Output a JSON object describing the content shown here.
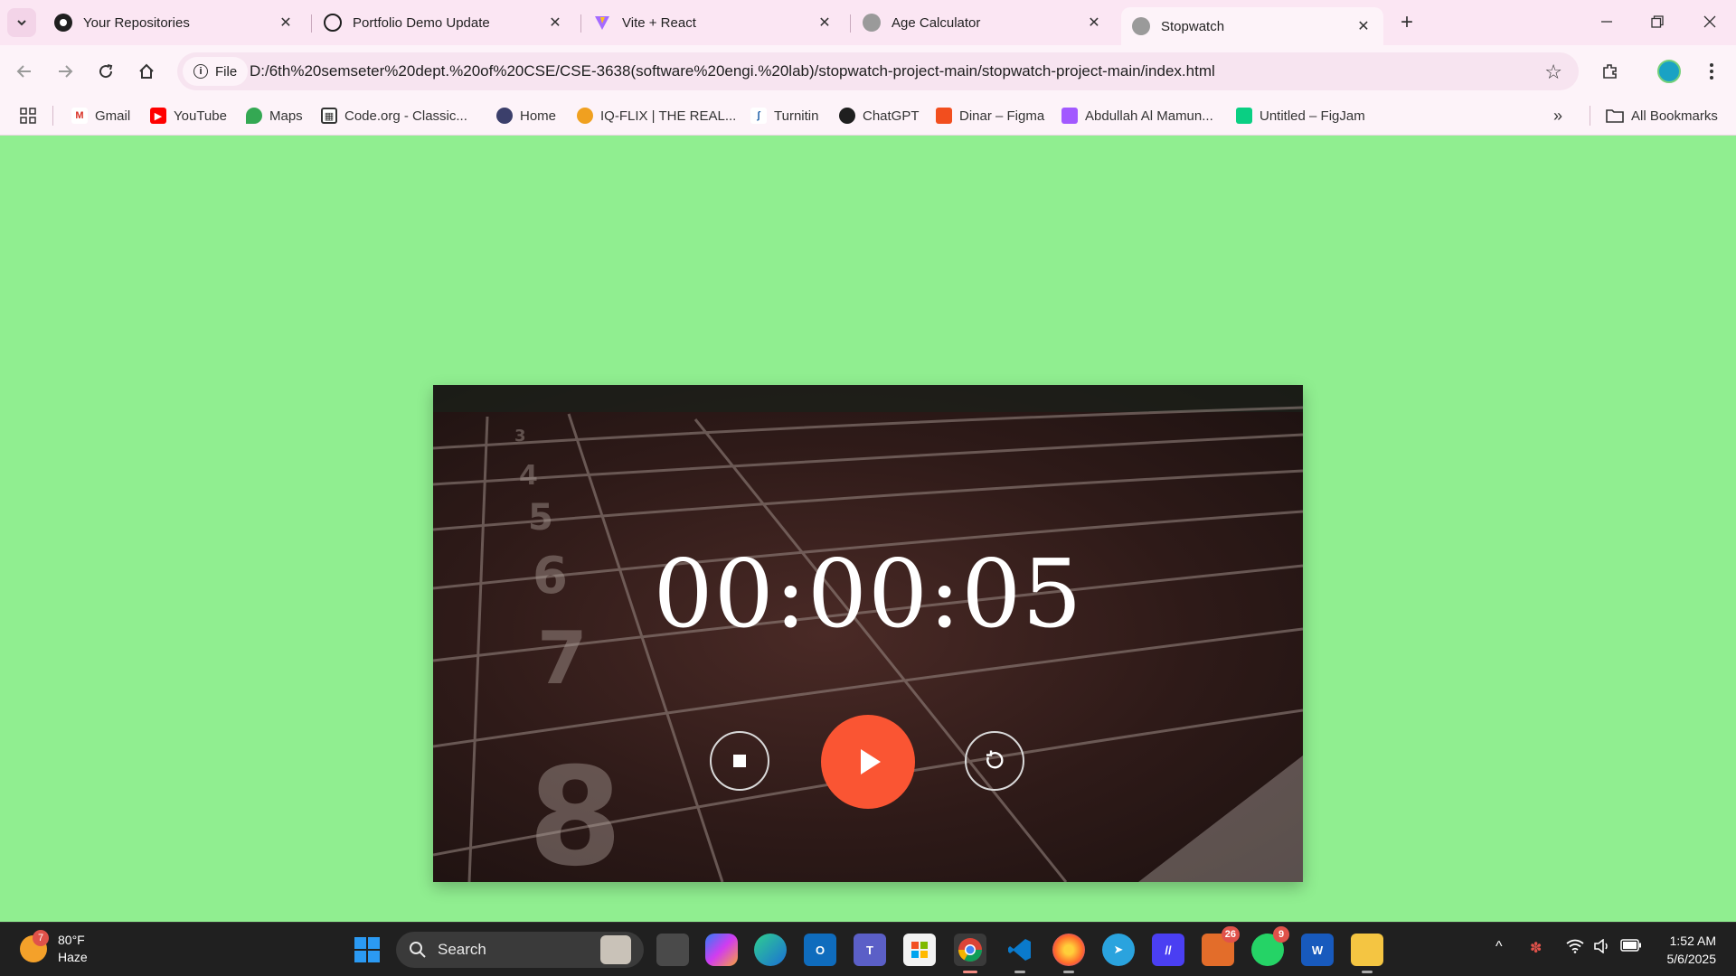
{
  "browser": {
    "tabs": [
      {
        "label": "Your Repositories",
        "icon": "github-icon"
      },
      {
        "label": "Portfolio Demo Update",
        "icon": "chatgpt-icon"
      },
      {
        "label": "Vite + React",
        "icon": "vite-icon"
      },
      {
        "label": "Age Calculator",
        "icon": "globe-icon"
      },
      {
        "label": "Stopwatch",
        "icon": "globe-icon",
        "active": true
      }
    ],
    "address": {
      "scheme_chip": "File",
      "url": "D:/6th%20semseter%20dept.%20of%20CSE/CSE-3638(software%20engi.%20lab)/stopwatch-project-main/stopwatch-project-main/index.html"
    },
    "bookmarks": [
      {
        "label": "Gmail",
        "icon": "gmail-icon"
      },
      {
        "label": "YouTube",
        "icon": "youtube-icon"
      },
      {
        "label": "Maps",
        "icon": "maps-icon"
      },
      {
        "label": "Code.org - Classic...",
        "icon": "codeorg-icon"
      },
      {
        "label": "Home",
        "icon": "home-bookmark-icon"
      },
      {
        "label": "IQ-FLIX | THE REAL...",
        "icon": "iqflix-icon"
      },
      {
        "label": "Turnitin",
        "icon": "turnitin-icon"
      },
      {
        "label": "ChatGPT",
        "icon": "chatgpt-icon"
      },
      {
        "label": "Dinar – Figma",
        "icon": "figma-icon"
      },
      {
        "label": "Abdullah Al Mamun...",
        "icon": "figma-icon"
      },
      {
        "label": "Untitled – FigJam",
        "icon": "figjam-icon"
      }
    ],
    "all_bookmarks": "All Bookmarks"
  },
  "stopwatch": {
    "time": "00:00:05",
    "colors": {
      "page_bg": "#90ee90",
      "play_button": "#fa5533"
    }
  },
  "taskbar": {
    "weather": {
      "temp": "80°F",
      "condition": "Haze",
      "badge": "7"
    },
    "search_placeholder": "Search",
    "badges": {
      "mail": "26",
      "whatsapp": "9"
    },
    "clock": {
      "time": "1:52 AM",
      "date": "5/6/2025"
    }
  }
}
